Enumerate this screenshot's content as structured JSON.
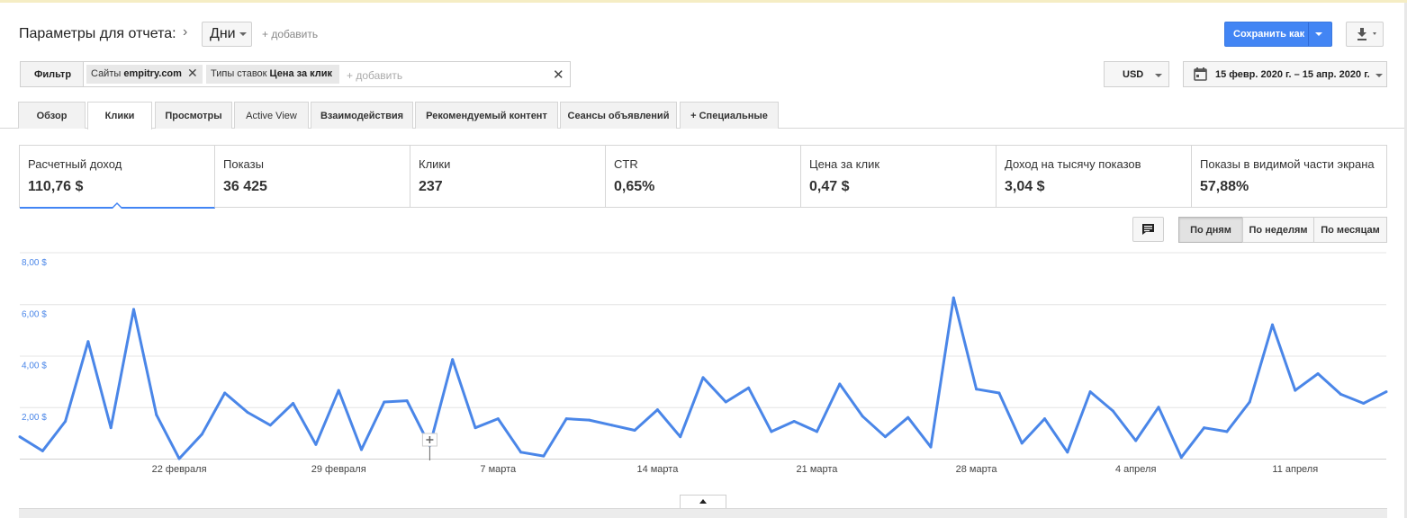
{
  "header": {
    "title": "Параметры для отчета:",
    "dimension": "Дни",
    "add_label": "+ добавить",
    "save_label": "Сохранить как"
  },
  "filter": {
    "label": "Фильтр",
    "chips": [
      {
        "key": "Сайты",
        "value": "empitry.com"
      },
      {
        "key": "Типы ставок",
        "value": "Цена за клик"
      }
    ],
    "add_placeholder": "+ добавить"
  },
  "currency": "USD",
  "date_range": "15 февр. 2020 г. – 15 апр. 2020 г.",
  "tabs": [
    {
      "label": "Обзор"
    },
    {
      "label": "Клики",
      "active": true
    },
    {
      "label": "Просмотры"
    },
    {
      "label": "Active View"
    },
    {
      "label": "Взаимодействия"
    },
    {
      "label": "Рекомендуемый контент"
    },
    {
      "label": "Сеансы объявлений"
    },
    {
      "label": "Специальные"
    }
  ],
  "metrics": [
    {
      "name": "Расчетный доход",
      "value": "110,76 $",
      "active": true
    },
    {
      "name": "Показы",
      "value": "36 425"
    },
    {
      "name": "Клики",
      "value": "237"
    },
    {
      "name": "CTR",
      "value": "0,65%"
    },
    {
      "name": "Цена за клик",
      "value": "0,47 $"
    },
    {
      "name": "Доход на тысячу показов",
      "value": "3,04 $"
    },
    {
      "name": "Показы в видимой части экрана",
      "value": "57,88%"
    }
  ],
  "views": [
    {
      "label": "По дням",
      "active": true
    },
    {
      "label": "По неделям"
    },
    {
      "label": "По месяцам"
    }
  ],
  "colors": {
    "accent": "#4285f4",
    "line": "#4a86e8",
    "axis_label": "#4a86e8"
  },
  "chart_data": {
    "type": "line",
    "ylim": [
      0,
      8
    ],
    "y_ticks": [
      {
        "value": 2,
        "label": "2,00 $"
      },
      {
        "value": 4,
        "label": "4,00 $"
      },
      {
        "value": 6,
        "label": "6,00 $"
      },
      {
        "value": 8,
        "label": "8,00 $"
      }
    ],
    "x_ticks": [
      {
        "index": 7,
        "label": "22 февраля"
      },
      {
        "index": 14,
        "label": "29 февраля"
      },
      {
        "index": 21,
        "label": "7 марта"
      },
      {
        "index": 28,
        "label": "14 марта"
      },
      {
        "index": 35,
        "label": "21 марта"
      },
      {
        "index": 42,
        "label": "28 марта"
      },
      {
        "index": 49,
        "label": "4 апреля"
      },
      {
        "index": 56,
        "label": "11 апреля"
      }
    ],
    "series": [
      {
        "values": [
          0.85,
          0.3,
          1.45,
          4.55,
          1.2,
          5.8,
          1.7,
          0.0,
          0.95,
          2.55,
          1.8,
          1.3,
          2.15,
          0.55,
          2.65,
          0.35,
          2.2,
          2.25,
          0.5,
          3.85,
          1.2,
          1.55,
          0.25,
          0.1,
          1.55,
          1.5,
          1.3,
          1.1,
          1.9,
          0.85,
          3.15,
          2.2,
          2.75,
          1.05,
          1.45,
          1.05,
          2.9,
          1.65,
          0.85,
          1.6,
          0.45,
          6.25,
          2.7,
          2.55,
          0.6,
          1.55,
          0.25,
          2.6,
          1.85,
          0.7,
          2.0,
          0.05,
          1.2,
          1.05,
          2.2,
          5.2,
          2.65,
          3.3,
          2.5,
          2.15,
          2.6
        ]
      }
    ]
  }
}
